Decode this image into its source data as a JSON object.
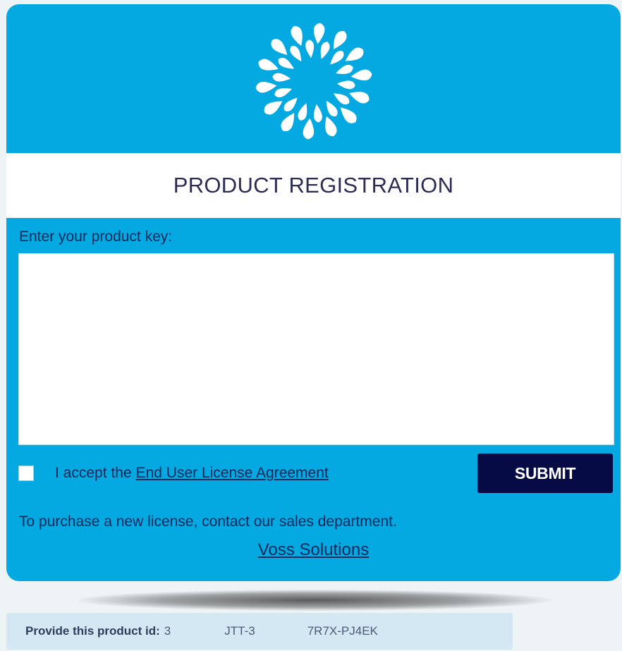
{
  "header": {
    "logo_icon": "flower-petal-logo-icon",
    "title": "PRODUCT REGISTRATION"
  },
  "form": {
    "key_label": "Enter your product key:",
    "key_value": "",
    "accept_prefix": "I accept the",
    "eula_link": "End User License Agreement",
    "accepted": false,
    "submit_label": "SUBMIT"
  },
  "footer": {
    "purchase_text": "To purchase a new license, contact our sales department.",
    "company_link": "Voss Solutions"
  },
  "product_id": {
    "label": "Provide this product id:",
    "part1": "3",
    "part2": "JTT-3",
    "part3": "7R7X-PJ4EK"
  },
  "colors": {
    "panel": "#03a9e0",
    "title_text": "#2d2c55",
    "submit_bg": "#070b45",
    "id_bar": "#d3e8f3"
  }
}
